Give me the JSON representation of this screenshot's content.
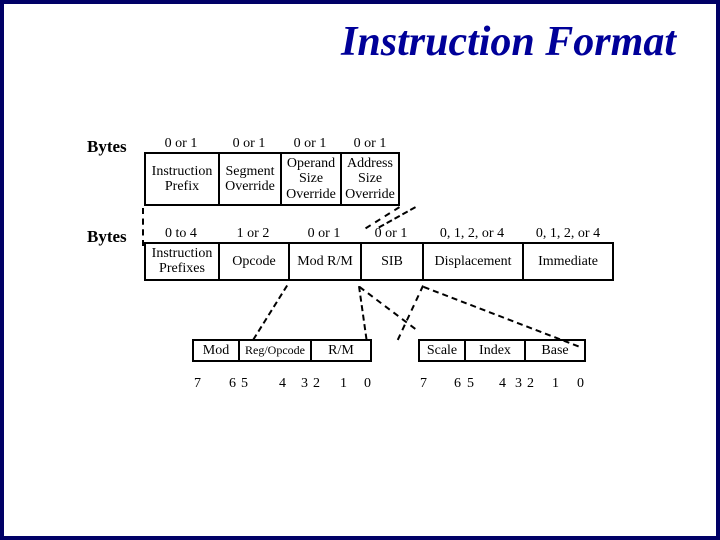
{
  "title": "Instruction Format",
  "labels": {
    "bytes": "Bytes"
  },
  "row1": {
    "headers": [
      "0 or 1",
      "0 or 1",
      "0 or 1",
      "0 or 1"
    ],
    "cells": [
      "Instruction\nPrefix",
      "Segment\nOverride",
      "Operand\nSize\nOverride",
      "Address\nSize\nOverride"
    ]
  },
  "row2": {
    "headers": [
      "0 to 4",
      "1 or 2",
      "0 or 1",
      "0 or 1",
      "0, 1, 2, or 4",
      "0, 1, 2, or 4"
    ],
    "cells": [
      "Instruction\nPrefixes",
      "Opcode",
      "Mod R/M",
      "SIB",
      "Displacement",
      "Immediate"
    ]
  },
  "row3": {
    "cells": [
      "Mod",
      "Reg/Opcode",
      "R/M"
    ],
    "cells2": [
      "Scale",
      "Index",
      "Base"
    ]
  },
  "bits": [
    "7",
    "6",
    "5",
    "4",
    "3",
    "2",
    "1",
    "0",
    "7",
    "6",
    "5",
    "4",
    "3",
    "2",
    "1",
    "0"
  ]
}
